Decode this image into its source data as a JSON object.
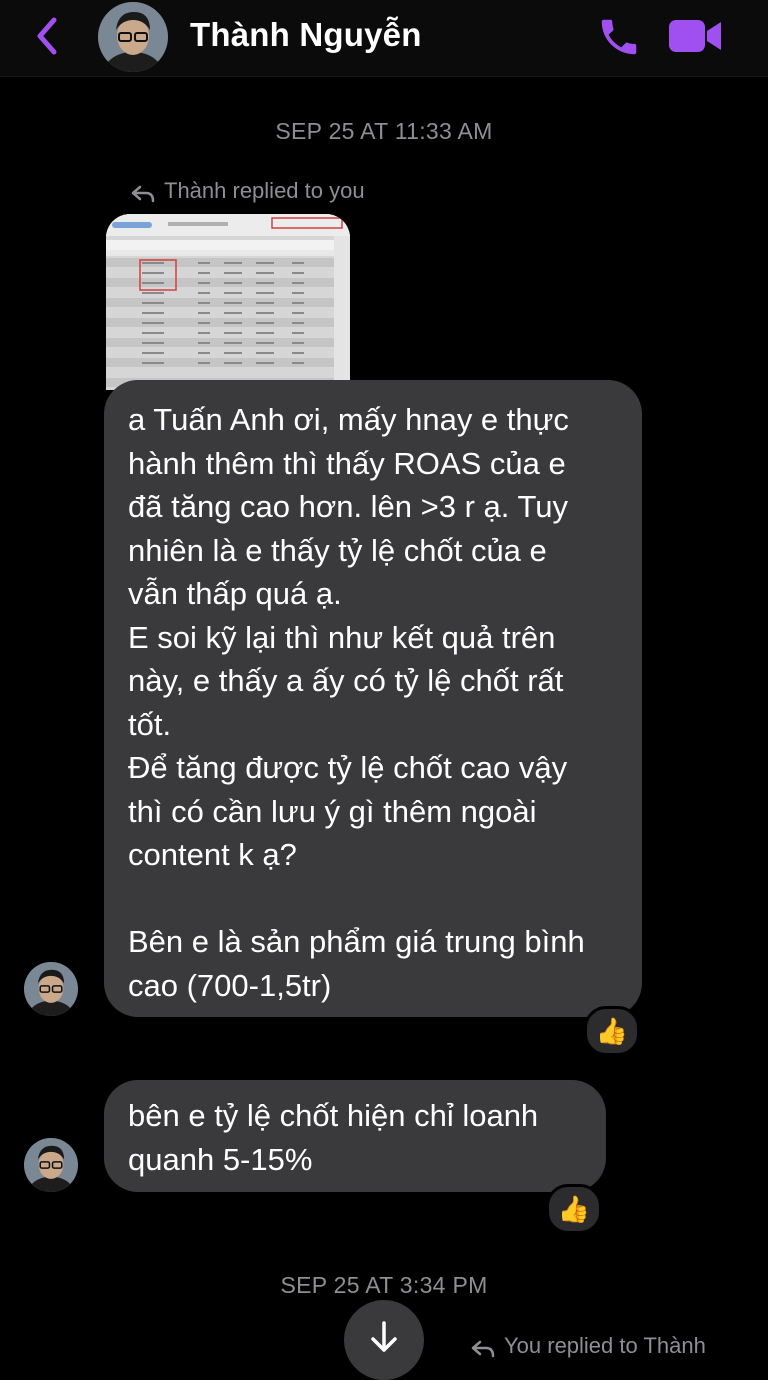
{
  "header": {
    "contact_name": "Thành Nguyễn",
    "back_icon": "chevron-left-icon",
    "call_icon": "phone-icon",
    "video_icon": "video-camera-icon",
    "accent_color": "#a050f0"
  },
  "timestamps": {
    "first": "SEP 25 AT 11:33 AM",
    "second": "SEP 25 AT 3:34 PM"
  },
  "reply_notes": {
    "incoming": "Thành replied to you",
    "outgoing": "You replied to Thành"
  },
  "messages": [
    {
      "lines": [
        "a Tuấn Anh ơi, mấy hnay e thực",
        "hành thêm thì thấy ROAS của e",
        "đã tăng cao hơn. lên >3 r ạ. Tuy",
        "nhiên là e thấy tỷ lệ chốt của e",
        "vẫn thấp quá ạ.",
        "E soi kỹ lại thì như kết quả trên",
        "này, e thấy a ấy có tỷ lệ chốt rất",
        "tốt.",
        "Để tăng được tỷ lệ chốt cao vậy",
        "thì có cần lưu ý gì thêm ngoài",
        "content k ạ?",
        "",
        "Bên e là sản phẩm giá trung bình",
        "cao (700-1,5tr)"
      ],
      "reaction": "👍"
    },
    {
      "lines": [
        "bên e tỷ lệ chốt hiện chỉ loanh",
        "quanh 5-15%"
      ],
      "reaction": "👍"
    }
  ],
  "bubble_color": "#3a3a3c"
}
